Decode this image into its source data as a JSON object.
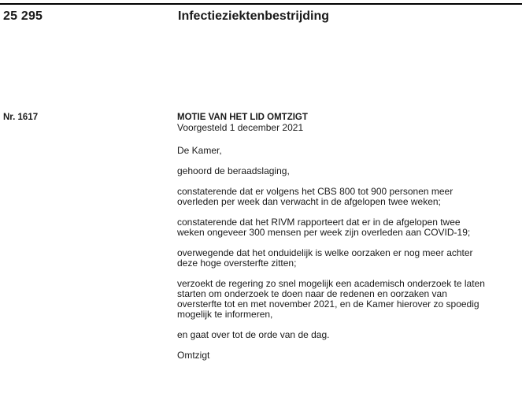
{
  "header": {
    "number": "25 295",
    "title": "Infectieziektenbestrijding"
  },
  "motion": {
    "number": "Nr. 1617",
    "heading": "MOTIE VAN HET LID OMTZIGT",
    "date": "Voorgesteld 1 december 2021",
    "paragraphs": [
      {
        "lines": [
          "De Kamer,"
        ]
      },
      {
        "lines": [
          "gehoord de beraadslaging,"
        ]
      },
      {
        "lines": [
          "constaterende dat er volgens het CBS 800 tot 900 personen meer",
          "overleden per week dan verwacht in de afgelopen twee weken;"
        ]
      },
      {
        "lines": [
          "constaterende dat het RIVM rapporteert dat er in de afgelopen twee",
          "weken ongeveer 300 mensen per week zijn overleden aan COVID-19;"
        ]
      },
      {
        "lines": [
          "overwegende dat het onduidelijk is welke oorzaken er nog meer achter",
          "deze hoge oversterfte zitten;"
        ]
      },
      {
        "lines": [
          "verzoekt de regering zo snel mogelijk een academisch onderzoek te laten",
          "starten om onderzoek te doen naar de redenen en oorzaken van",
          "oversterfte tot en met november 2021, en de Kamer hierover zo spoedig",
          "mogelijk te informeren,"
        ]
      },
      {
        "lines": [
          "en gaat over tot de orde van de dag."
        ]
      },
      {
        "lines": [
          "Omtzigt"
        ]
      }
    ]
  }
}
